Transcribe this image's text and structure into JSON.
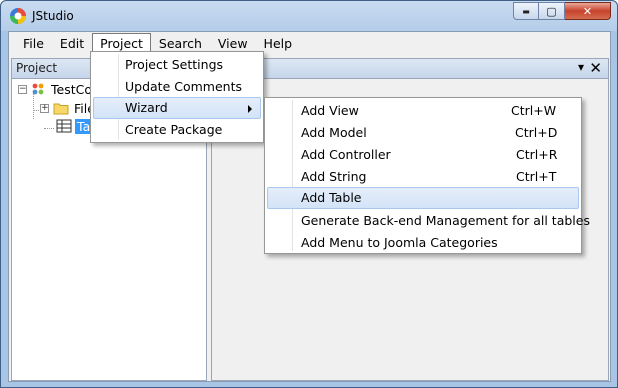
{
  "window": {
    "title": "JStudio",
    "minimize_glyph": "▬",
    "maximize_glyph": "▢",
    "close_glyph": "✕"
  },
  "menubar": {
    "items": [
      {
        "label": "File"
      },
      {
        "label": "Edit"
      },
      {
        "label": "Project"
      },
      {
        "label": "Search"
      },
      {
        "label": "View"
      },
      {
        "label": "Help"
      }
    ]
  },
  "project_panel": {
    "title": "Project",
    "tree": [
      {
        "label": "TestCo",
        "expander": "−"
      },
      {
        "label": "File",
        "expander": "+"
      },
      {
        "label": "Tab"
      }
    ]
  },
  "right_panel": {
    "pin_glyph": "▾",
    "close_glyph": "✕"
  },
  "project_menu": {
    "items": [
      {
        "label": "Project Settings"
      },
      {
        "label": "Update Comments"
      },
      {
        "label": "Wizard"
      },
      {
        "label": "Create Package"
      }
    ]
  },
  "wizard_menu": {
    "items": [
      {
        "label": "Add View",
        "shortcut": "Ctrl+W"
      },
      {
        "label": "Add Model",
        "shortcut": "Ctrl+D"
      },
      {
        "label": "Add Controller",
        "shortcut": "Ctrl+R"
      },
      {
        "label": "Add String",
        "shortcut": "Ctrl+T"
      },
      {
        "label": "Add Table",
        "shortcut": ""
      },
      {
        "label": "Generate Back-end Management for all tables",
        "shortcut": ""
      },
      {
        "label": "Add Menu to Joomla Categories",
        "shortcut": ""
      }
    ]
  },
  "colors": {
    "selection": "#3399ff",
    "menu_highlight": "#d3e3f7",
    "titlebar": "#b4cde9"
  }
}
